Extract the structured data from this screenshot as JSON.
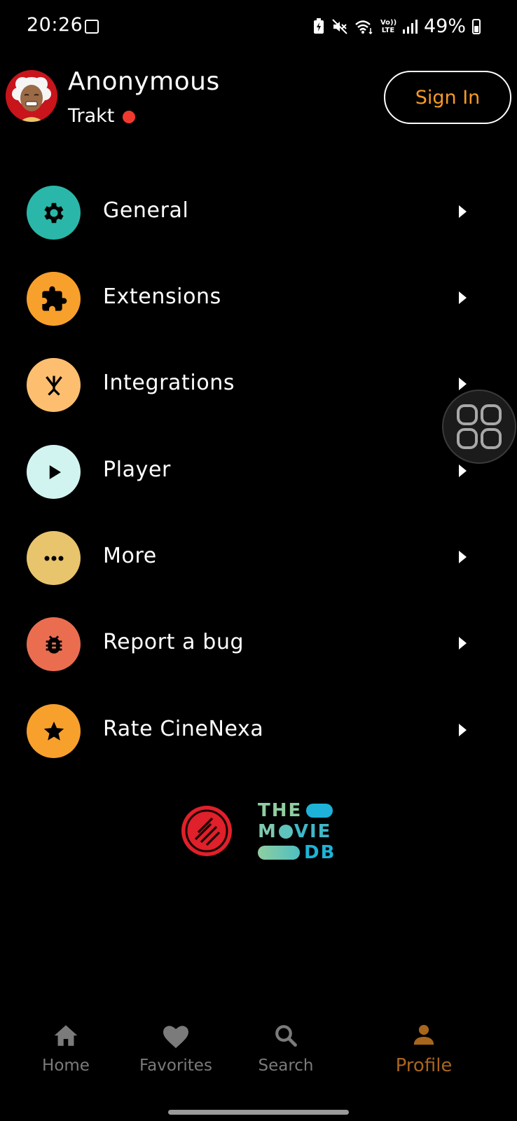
{
  "status_bar": {
    "time": "20:26",
    "battery": "49%",
    "volte": "Vo)) LTE"
  },
  "header": {
    "user_name": "Anonymous",
    "trakt_label": "Trakt",
    "sign_in_label": "Sign In"
  },
  "menu": {
    "items": [
      {
        "label": "General",
        "icon": "gear-icon",
        "color": "#2ab7a9"
      },
      {
        "label": "Extensions",
        "icon": "puzzle-icon",
        "color": "#f7a02c"
      },
      {
        "label": "Integrations",
        "icon": "merge-icon",
        "color": "#fdbf6f"
      },
      {
        "label": "Player",
        "icon": "play-icon",
        "color": "#d2f4f1"
      },
      {
        "label": "More",
        "icon": "more-icon",
        "color": "#e8c46c"
      },
      {
        "label": "Report a bug",
        "icon": "bug-icon",
        "color": "#ea6d50"
      },
      {
        "label": "Rate CineNexa",
        "icon": "star-icon",
        "color": "#f7a02c"
      }
    ]
  },
  "logos": {
    "tmdb_line1": "THE",
    "tmdb_line2_a": "M",
    "tmdb_line2_b": "VIE",
    "tmdb_line3": "DB"
  },
  "bottom_nav": {
    "items": [
      {
        "label": "Home",
        "icon": "home-icon"
      },
      {
        "label": "Favorites",
        "icon": "heart-icon"
      },
      {
        "label": "Search",
        "icon": "search-icon"
      },
      {
        "label": "Profile",
        "icon": "person-icon",
        "active": true
      }
    ]
  },
  "colors": {
    "accent": "#f79a28",
    "active_nav": "#a8651c",
    "inactive_nav": "#7b7b7b",
    "background": "#000000"
  }
}
